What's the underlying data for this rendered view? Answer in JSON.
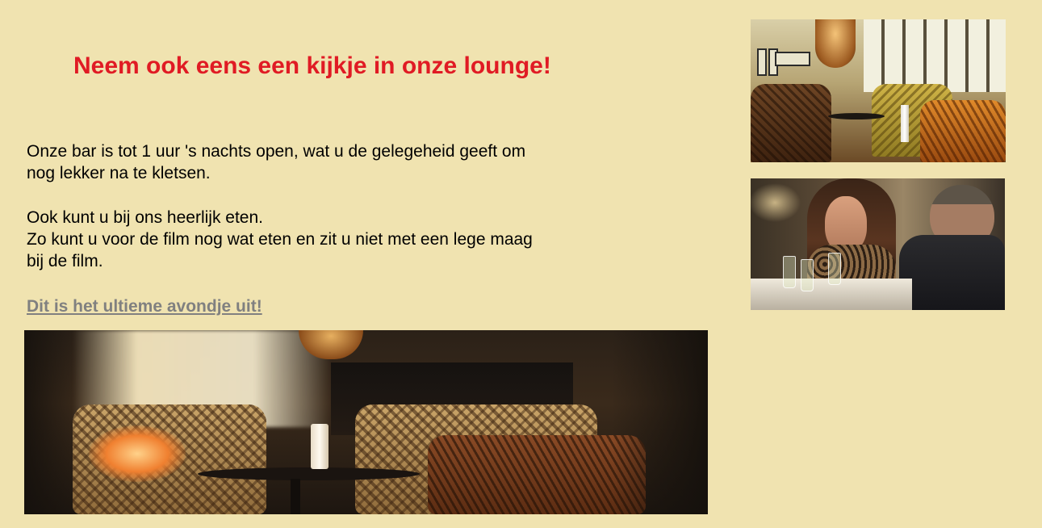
{
  "page": {
    "title": "Neem ook eens een kijkje in onze lounge!",
    "paragraphs": {
      "p1": "Onze bar is tot 1 uur 's nachts open, wat u de gelegeheid geeft om nog lekker na te kletsen.",
      "p2_line1": "Ook kunt u bij ons heerlijk eten.",
      "p2_line2": "Zo kunt u voor de film nog wat eten en zit u niet met een lege maag bij de film."
    },
    "cta_link": "Dit is het ultieme avondje uit! "
  },
  "colors": {
    "background": "#f0e3b0",
    "title": "#e01b24",
    "link": "#808080",
    "text": "#000000"
  },
  "images": {
    "lounge_large": "lounge-interior-photo",
    "bar_small": "bar-lounge-photo",
    "dinner": "dining-couple-photo"
  }
}
